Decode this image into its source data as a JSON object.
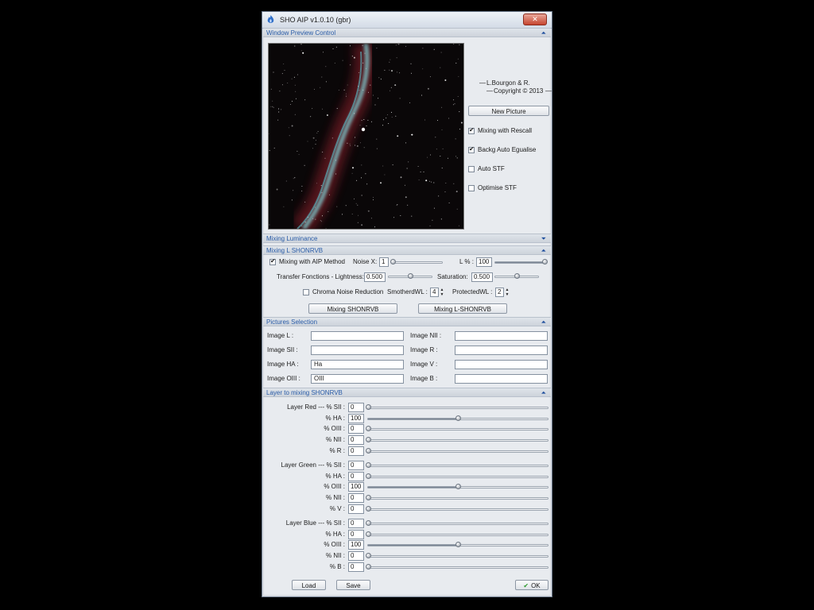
{
  "window": {
    "title": "SHO AIP v1.0.10 (gbr)",
    "close": "✕"
  },
  "preview_section": {
    "label": "Window Preview Control",
    "chevron": "⏶"
  },
  "credits": {
    "line1": "L.Bourgon & R.",
    "line2": "Copyright © 2013"
  },
  "new_picture": "New Picture",
  "opts": [
    {
      "label": "Mixing with Rescall",
      "checked": true
    },
    {
      "label": "Backg Auto Egualise",
      "checked": true
    },
    {
      "label": "Auto STF",
      "checked": false
    },
    {
      "label": "Optimise STF",
      "checked": false
    }
  ],
  "mixing_luminance": {
    "label": "Mixing Luminance",
    "chevron": "⏷"
  },
  "mixing_l": {
    "label": "Mixing L SHONRVB",
    "chevron": "⏶",
    "aip_label": "Mixing with AIP Method",
    "aip_checked": true,
    "noise_label": "Noise X:",
    "noise_value": "1",
    "noise_level": 0.0,
    "lpct_label": "L % :",
    "lpct_value": "100",
    "lpct_level": 1.0,
    "transfer_label": "Transfer Fonctions - Lightness:",
    "transfer_value": "0.500",
    "transfer_level": 0.5,
    "saturation_label": "Saturation:",
    "saturation_value": "0.500",
    "saturation_level": 0.5,
    "chroma_label": "Chroma Noise Reduction",
    "chroma_checked": false,
    "smothered_label": "SmotherdWL :",
    "smothered_value": "4",
    "protected_label": "ProtectedWL :",
    "protected_value": "2",
    "btn_shonrvb": "Mixing SHONRVB",
    "btn_lshonrvb": "Mixing L-SHONRVB"
  },
  "pictures": {
    "label": "Pictures Selection",
    "chevron": "⏶",
    "left": [
      {
        "label": "Image L :",
        "value": ""
      },
      {
        "label": "Image SII :",
        "value": ""
      },
      {
        "label": "Image HA :",
        "value": "Ha"
      },
      {
        "label": "Image OIII :",
        "value": "OIII"
      }
    ],
    "right": [
      {
        "label": "Image NII :",
        "value": ""
      },
      {
        "label": "Image R :",
        "value": ""
      },
      {
        "label": "Image V :",
        "value": ""
      },
      {
        "label": "Image B :",
        "value": ""
      }
    ]
  },
  "layer_section": {
    "label": "Layer to mixing SHONRVB",
    "chevron": "⏶"
  },
  "layers": [
    {
      "name": "Layer Red",
      "rows": [
        {
          "label": "% SII :",
          "value": "0",
          "level": 0
        },
        {
          "label": "% HA :",
          "value": "100",
          "level": 0.5
        },
        {
          "label": "% OIII :",
          "value": "0",
          "level": 0
        },
        {
          "label": "% NII :",
          "value": "0",
          "level": 0
        },
        {
          "label": "% R :",
          "value": "0",
          "level": 0
        }
      ]
    },
    {
      "name": "Layer Green",
      "rows": [
        {
          "label": "% SII :",
          "value": "0",
          "level": 0
        },
        {
          "label": "% HA :",
          "value": "0",
          "level": 0
        },
        {
          "label": "% OIII :",
          "value": "100",
          "level": 0.5
        },
        {
          "label": "% NII :",
          "value": "0",
          "level": 0
        },
        {
          "label": "% V :",
          "value": "0",
          "level": 0
        }
      ]
    },
    {
      "name": "Layer Blue",
      "rows": [
        {
          "label": "% SII :",
          "value": "0",
          "level": 0
        },
        {
          "label": "% HA :",
          "value": "0",
          "level": 0
        },
        {
          "label": "% OIII :",
          "value": "100",
          "level": 0.5
        },
        {
          "label": "% NII :",
          "value": "0",
          "level": 0
        },
        {
          "label": "% B :",
          "value": "0",
          "level": 0
        }
      ]
    }
  ],
  "footer": {
    "load": "Load",
    "save": "Save",
    "ok": "OK",
    "ok_icon": "✔"
  },
  "colors": {
    "accent": "#2b5da8",
    "ok_check": "#2e9b2e"
  }
}
